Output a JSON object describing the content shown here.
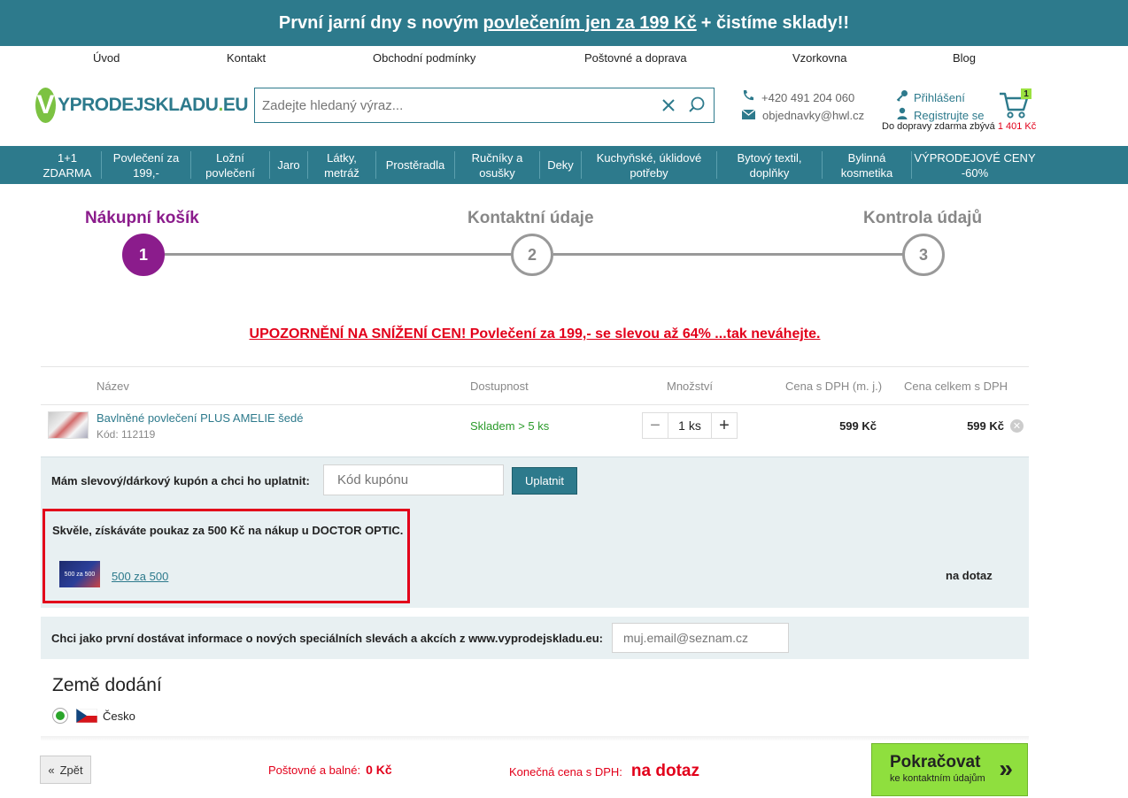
{
  "topbar": {
    "pre": "První jarní dny s novým",
    "link": "povlečením jen za 199 Kč",
    "post": "+ čistíme sklady!!"
  },
  "nav_top": [
    "Úvod",
    "Kontakt",
    "Obchodní podmínky",
    "Poštovné a doprava",
    "Vzorkovna",
    "Blog"
  ],
  "logo": {
    "letter": "V",
    "a": "YPRODEJSKLADU",
    "dot": ".",
    "b": "EU"
  },
  "search": {
    "placeholder": "Zadejte hledaný výraz..."
  },
  "contact": {
    "phone": "+420 491 204 060",
    "email": "objednavky@hwl.cz"
  },
  "user": {
    "login": "Přihlášení",
    "register": "Registrujte se"
  },
  "cart": {
    "count": "1"
  },
  "free_shipping": {
    "text": "Do dopravy zdarma zbývá",
    "amount": "1 401 Kč"
  },
  "nav_cat": [
    "1+1 ZDARMA",
    "Povlečení za 199,-",
    "Ložní povlečení",
    "Jaro",
    "Látky, metráž",
    "Prostěradla",
    "Ručníky a osušky",
    "Deky",
    "Kuchyňské, úklidové potřeby",
    "Bytový textil, doplňky",
    "Bylinná kosmetika",
    "VÝPRODEJOVÉ CENY -60%"
  ],
  "steps": [
    {
      "label": "Nákupní košík",
      "num": "1"
    },
    {
      "label": "Kontaktní údaje",
      "num": "2"
    },
    {
      "label": "Kontrola údajů",
      "num": "3"
    }
  ],
  "warning": "UPOZORNĚNÍ NA SNÍŽENÍ CEN! Povlečení za 199,- se slevou až 64% ...tak neváhejte.",
  "table": {
    "headers": {
      "name": "Název",
      "avail": "Dostupnost",
      "qty": "Množství",
      "unit": "Cena s DPH (m. j.)",
      "total": "Cena celkem s DPH"
    }
  },
  "product": {
    "name": "Bavlněné povlečení PLUS AMELIE šedé",
    "code": "Kód: 112119",
    "avail": "Skladem > 5 ks",
    "qty": "1 ks",
    "unit_price": "599 Kč",
    "total_price": "599 Kč"
  },
  "coupon": {
    "label": "Mám slevový/dárkový kupón a chci ho uplatnit:",
    "placeholder": "Kód kupónu",
    "button": "Uplatnit"
  },
  "promo": {
    "text": "Skvěle, získáváte poukaz za 500 Kč na nákup u DOCTOR OPTIC.",
    "img_text": "500 za 500",
    "link": "500 za 500",
    "price": "na dotaz"
  },
  "newsletter": {
    "label": "Chci jako první dostávat informace o nových speciálních slevách a akcích z www.vyprodejskladu.eu:",
    "placeholder": "muj.email@seznam.cz"
  },
  "country": {
    "title": "Země dodání",
    "name": "Česko"
  },
  "footer": {
    "back": "Zpět",
    "shipping_label": "Poštovné a balné:",
    "shipping_value": "0 Kč",
    "final_label": "Konečná cena s DPH:",
    "final_value": "na dotaz",
    "next_title": "Pokračovat",
    "next_sub": "ke kontaktním údajům"
  },
  "colors": {
    "teal": "#2d7a8c",
    "purple": "#8b1c8c",
    "red": "#e2001a",
    "green": "#8fdf3e"
  }
}
